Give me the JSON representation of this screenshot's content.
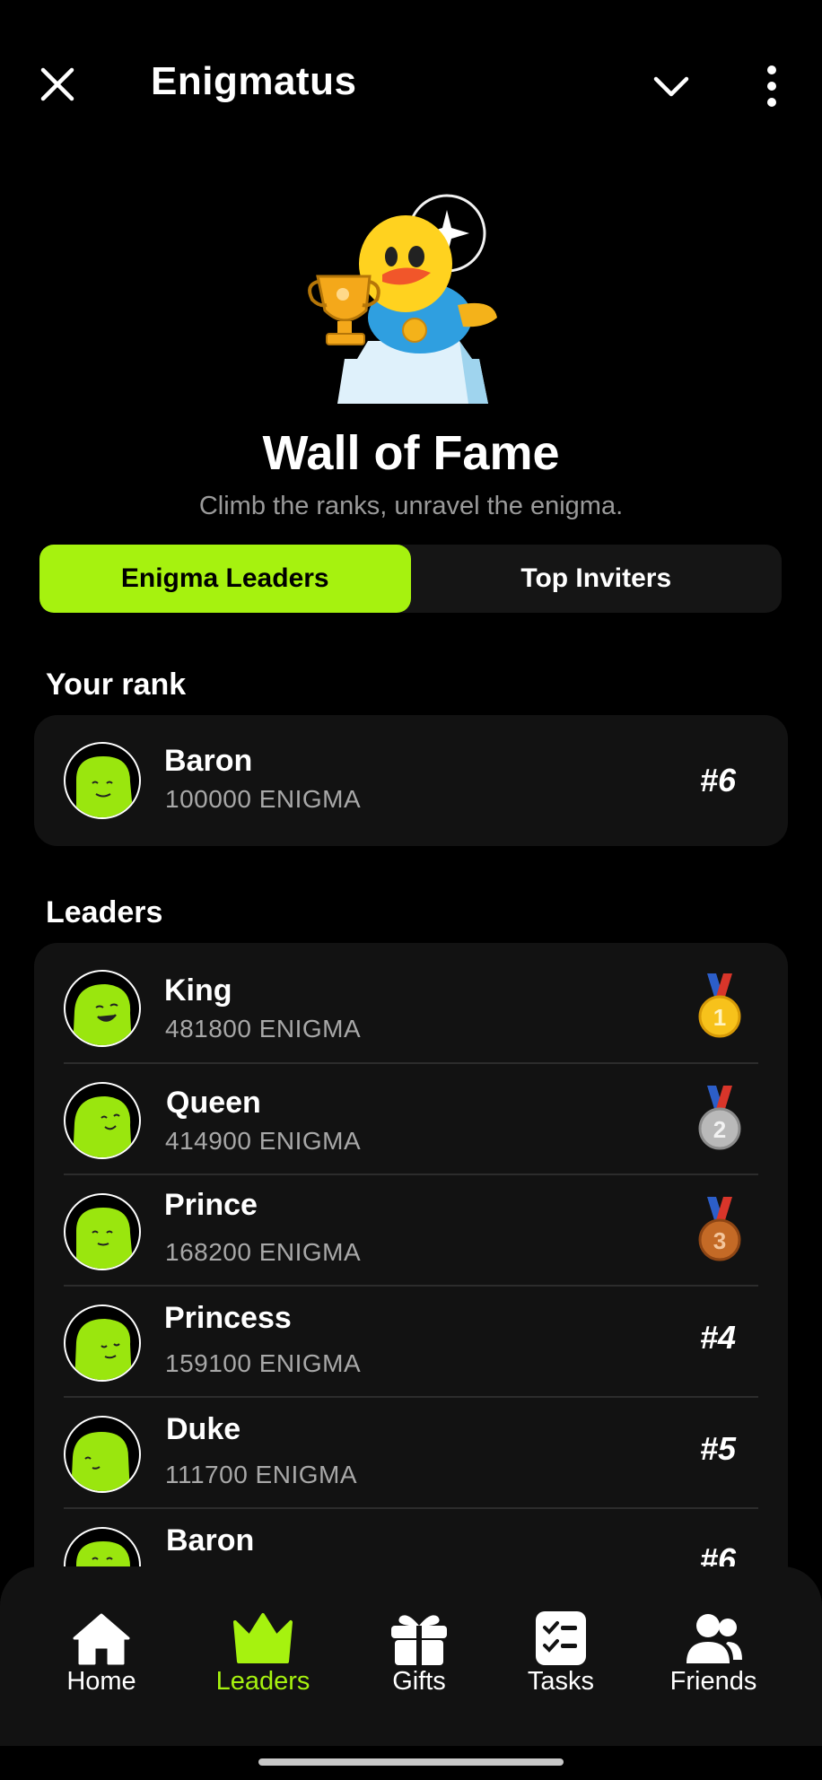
{
  "header": {
    "title": "Enigmatus"
  },
  "hero": {
    "title": "Wall of Fame",
    "subtitle": "Climb the ranks, unravel the enigma."
  },
  "tabs": [
    {
      "label": "Enigma Leaders",
      "active": true
    },
    {
      "label": "Top Inviters",
      "active": false
    }
  ],
  "your_rank": {
    "label": "Your rank",
    "name": "Baron",
    "score": "100000 ENIGMA",
    "rank": "#6"
  },
  "leaders": {
    "label": "Leaders",
    "rows": [
      {
        "name": "King",
        "score": "481800 ENIGMA",
        "medal": "gold-medal-icon",
        "medal_num": "1"
      },
      {
        "name": "Queen",
        "score": "414900 ENIGMA",
        "medal": "silver-medal-icon",
        "medal_num": "2"
      },
      {
        "name": "Prince",
        "score": "168200 ENIGMA",
        "medal": "bronze-medal-icon",
        "medal_num": "3"
      },
      {
        "name": "Princess",
        "score": "159100 ENIGMA",
        "rank": "#4"
      },
      {
        "name": "Duke",
        "score": "111700 ENIGMA",
        "rank": "#5"
      },
      {
        "name": "Baron",
        "score": "",
        "rank": "#6"
      }
    ]
  },
  "nav": [
    {
      "label": "Home",
      "icon": "home-icon",
      "active": false
    },
    {
      "label": "Leaders",
      "icon": "crown-icon",
      "active": true
    },
    {
      "label": "Gifts",
      "icon": "gift-icon",
      "active": false
    },
    {
      "label": "Tasks",
      "icon": "tasks-icon",
      "active": false
    },
    {
      "label": "Friends",
      "icon": "friends-icon",
      "active": false
    }
  ],
  "colors": {
    "accent": "#a6f20f",
    "background": "#000000",
    "card": "#121212"
  }
}
